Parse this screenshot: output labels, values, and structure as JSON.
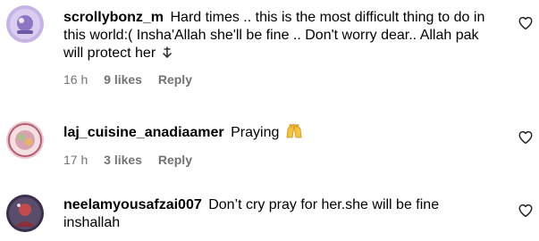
{
  "comments": [
    {
      "username": "scrollybonz_m",
      "text": "Hard times .. this is the most difficult thing to do in this world:( Insha'Allah she'll be fine .. Don't worry dear.. Allah pak will protect her",
      "emoji": "downwards-arrow-icon",
      "time": "16 h",
      "likes": "9 likes",
      "reply": "Reply"
    },
    {
      "username": "laj_cuisine_anadiaamer",
      "text": "Praying",
      "emoji": "raised-hands-icon",
      "time": "17 h",
      "likes": "3 likes",
      "reply": "Reply"
    },
    {
      "username": "neelamyousafzai007",
      "text": "Don’t cry pray for her.she will be fine inshallah"
    }
  ],
  "colors": {
    "text": "#000000",
    "meta": "#737373",
    "heart_stroke": "#262626",
    "emoji_yellow": "#f7c33b"
  }
}
